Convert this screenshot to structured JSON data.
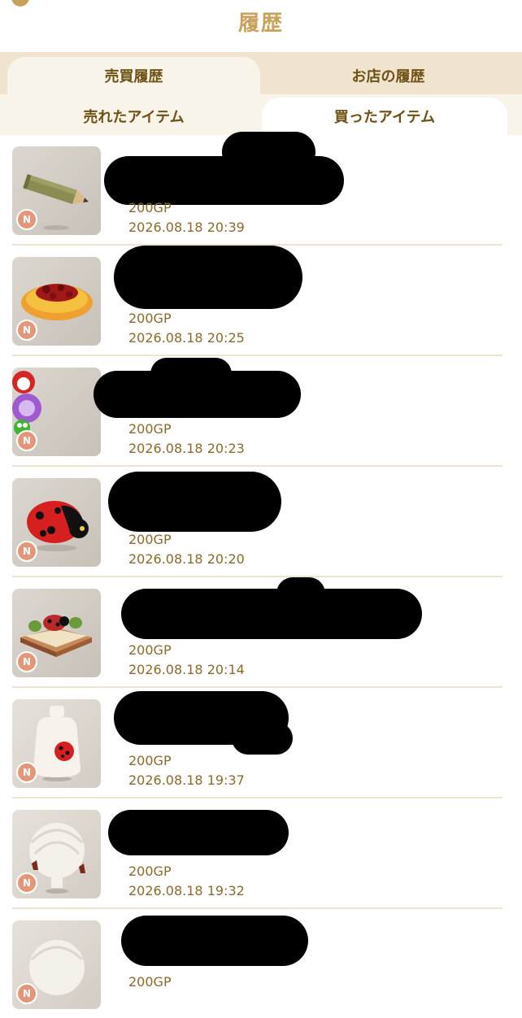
{
  "header": {
    "title": "履歴"
  },
  "tabs_primary": [
    {
      "label": "売買履歴",
      "active": true
    },
    {
      "label": "お店の履歴",
      "active": false
    }
  ],
  "tabs_secondary": [
    {
      "label": "売れたアイテム",
      "active": false
    },
    {
      "label": "買ったアイテム",
      "active": true
    }
  ],
  "items": [
    {
      "badge": "N",
      "price": "200GP",
      "date": "2026.08.18 20:39",
      "icon": "pencil-icon"
    },
    {
      "badge": "N",
      "price": "200GP",
      "date": "2026.08.18 20:25",
      "icon": "spaghetti-icon"
    },
    {
      "badge": "N",
      "price": "200GP",
      "date": "2026.08.18 20:23",
      "icon": "character-cluster-icon"
    },
    {
      "badge": "N",
      "price": "200GP",
      "date": "2026.08.18 20:20",
      "icon": "ladybug-icon"
    },
    {
      "badge": "N",
      "price": "200GP",
      "date": "2026.08.18 20:14",
      "icon": "ladybug-book-icon"
    },
    {
      "badge": "N",
      "price": "200GP",
      "date": "2026.08.18 19:37",
      "icon": "ladybug-sack-icon"
    },
    {
      "badge": "N",
      "price": "200GP",
      "date": "2026.08.18 19:32",
      "icon": "white-hair-icon"
    },
    {
      "badge": "N",
      "price": "200GP",
      "date": "",
      "icon": "white-hair-icon"
    }
  ]
}
